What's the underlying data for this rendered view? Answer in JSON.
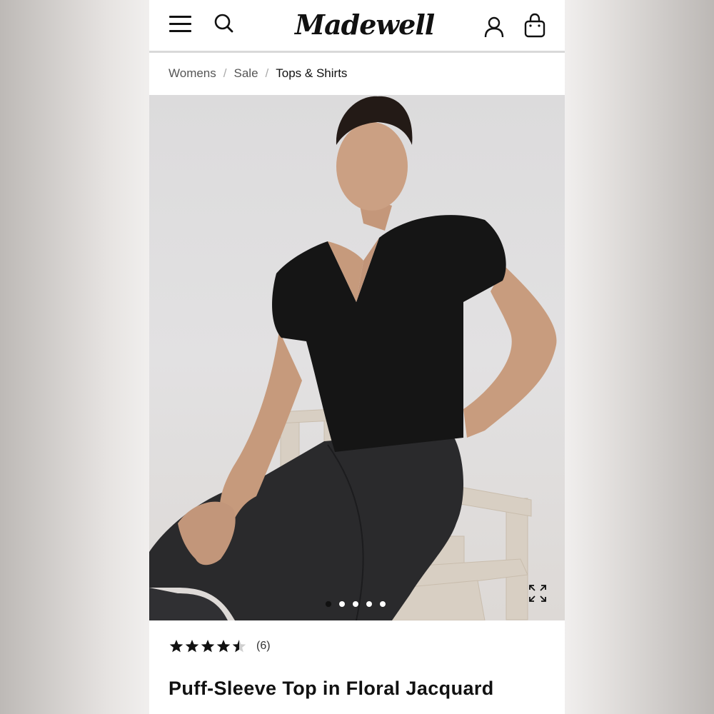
{
  "header": {
    "logo_text": "Madewell",
    "menu_icon": "hamburger-menu-icon",
    "search_icon": "search-icon",
    "account_icon": "account-icon",
    "bag_icon": "shopping-bag-icon"
  },
  "breadcrumb": {
    "items": [
      {
        "label": "Womens"
      },
      {
        "label": "Sale"
      },
      {
        "label": "Tops & Shirts"
      }
    ],
    "separator": "/"
  },
  "gallery": {
    "image_count": 5,
    "active_index": 0,
    "expand_icon": "expand-icon"
  },
  "product": {
    "rating": 4.5,
    "rating_max": 5,
    "review_count": "(6)",
    "title": "Puff-Sleeve Top in Floral Jacquard"
  },
  "colors": {
    "text": "#111111",
    "breadcrumb_muted": "#555555",
    "divider": "#d9d9d9"
  }
}
